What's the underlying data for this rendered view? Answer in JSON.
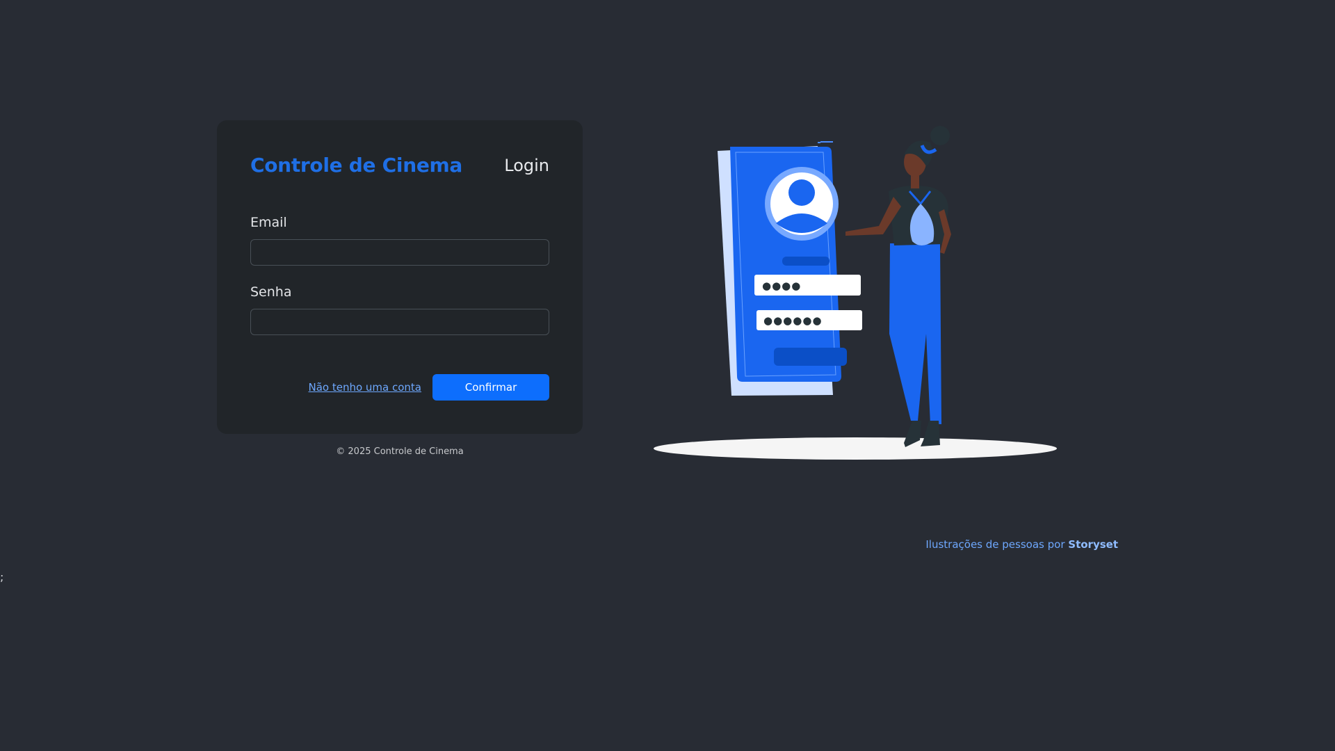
{
  "stray_text": ";",
  "card": {
    "brand": "Controle de Cinema",
    "title": "Login"
  },
  "form": {
    "email_label": "Email",
    "email_value": "",
    "password_label": "Senha",
    "password_value": "",
    "signup_link": "Não tenho uma conta",
    "confirm_button": "Confirmar"
  },
  "footer": {
    "copyright": "© 2025 Controle de Cinema"
  },
  "credit": {
    "prefix": "Ilustrações de pessoas por",
    "source": "Storyset"
  },
  "illustration": {
    "icon": "login-illustration-icon",
    "password_dots_1": "●●●●",
    "password_dots_2": "●●●●●●"
  },
  "colors": {
    "background": "#282c34",
    "card": "#212529",
    "accent": "#0d6efd",
    "brand": "#1f6fe5",
    "link": "#6ea8fe"
  }
}
